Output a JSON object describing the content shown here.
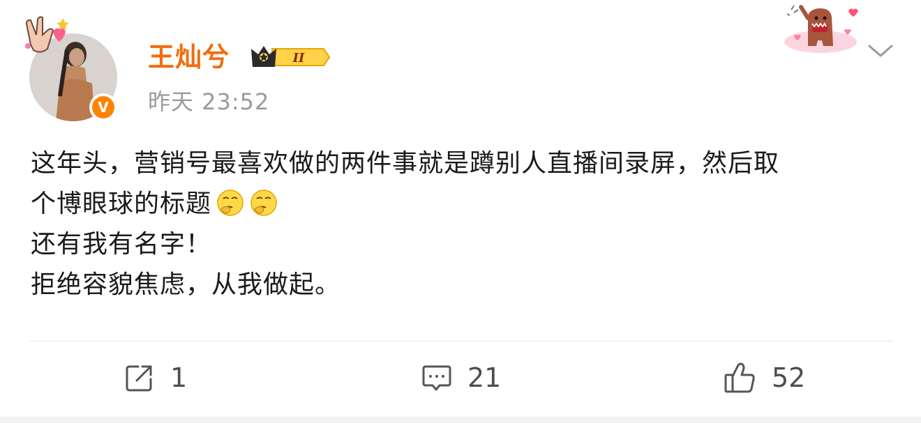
{
  "post": {
    "username": "王灿兮",
    "timestamp": "昨天 23:52",
    "verified_mark": "V",
    "vip_level": "II",
    "text_lines": [
      "这年头，营销号最喜欢做的两件事就是蹲别人直播间录屏，然后取",
      "个博眼球的标题",
      "还有我有名字！",
      "拒绝容貌焦虑，从我做起。"
    ],
    "emojis": [
      "thinking-emoji-icon",
      "thinking-emoji-icon"
    ]
  },
  "actions": {
    "repost_count": "1",
    "comment_count": "21",
    "like_count": "52"
  },
  "icons": {
    "repost": "share-icon",
    "comment": "comment-icon",
    "like": "thumbs-up-icon",
    "more": "chevron-down-icon"
  },
  "colors": {
    "username": "#f26d0e",
    "verified": "#ff8200",
    "timestamp": "#9a9a9a",
    "text": "#1a1a1a",
    "action": "#4d4d4d"
  }
}
